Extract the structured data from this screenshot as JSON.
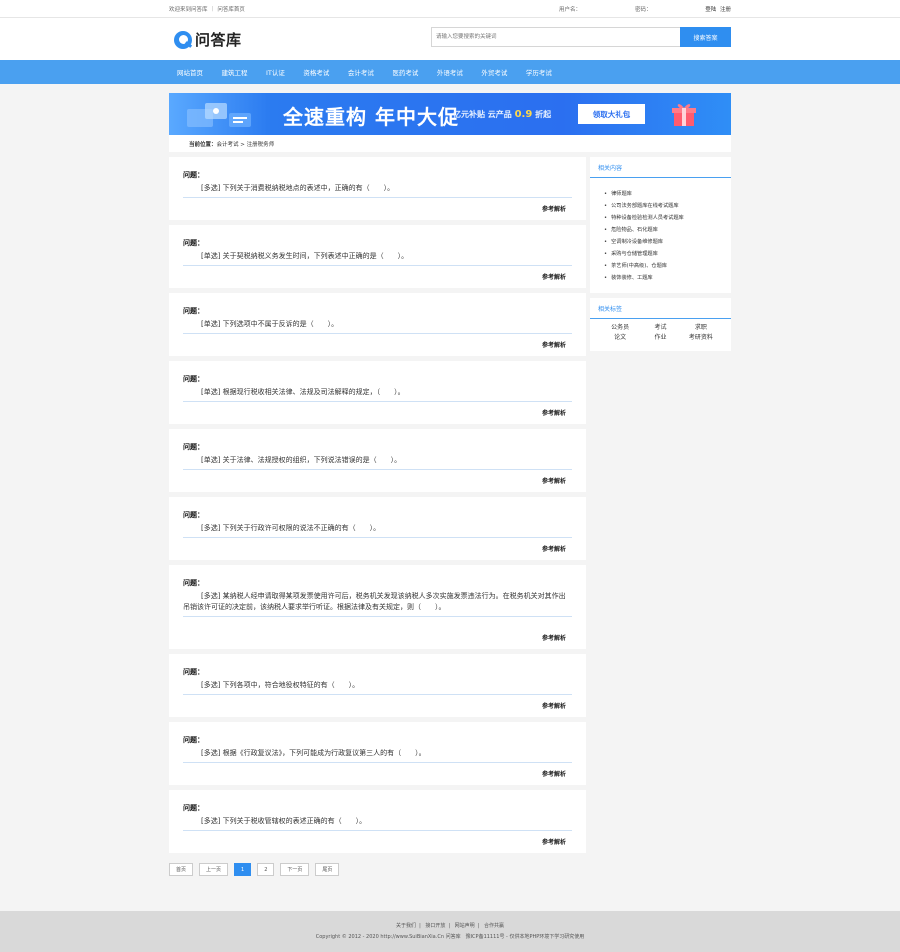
{
  "topbar": {
    "welcome": "欢迎来到问答库",
    "home_link": "问答库首页",
    "user_label": "用户名：",
    "pass_label": "密码：",
    "register": "登陆",
    "login": "注册"
  },
  "header": {
    "logo_text": "问答库",
    "search_placeholder": "请输入您要搜索的关键词",
    "search_button": "搜索答案"
  },
  "nav": [
    "网站首页",
    "建筑工程",
    "IT认证",
    "资格考试",
    "会计考试",
    "医药考试",
    "外语考试",
    "外贸考试",
    "学历考试"
  ],
  "banner": {
    "headline": "全速重构 年中大促",
    "sub_prefix": "亿元补贴 云产品",
    "sub_highlight": "0.9",
    "sub_suffix": "折起",
    "cta": "领取大礼包"
  },
  "breadcrumb": {
    "label": "当前位置：",
    "path": "会计考试 > 注册税务师"
  },
  "question_label": "问题：",
  "answer_label": "参考解析",
  "questions": [
    {
      "text": "[多选] 下列关于消费税纳税地点的表述中，正确的有（　　）。",
      "tall": false
    },
    {
      "text": "[单选] 关于契税纳税义务发生时间，下列表述中正确的是（　　）。",
      "tall": false
    },
    {
      "text": "[单选] 下列选项中不属于反诉的是（　　）。",
      "tall": false
    },
    {
      "text": "[单选] 根据现行税收相关法律、法规及司法解释的规定，（　　）。",
      "tall": false
    },
    {
      "text": "[单选] 关于法律、法规授权的组织，下列说法错误的是（　　）。",
      "tall": false
    },
    {
      "text": "[多选] 下列关于行政许可权限的说法不正确的有（　　）。",
      "tall": false
    },
    {
      "text": "[多选] 某纳税人经申请取得某项发票使用许可后，税务机关发现该纳税人多次实施发票违法行为。在税务机关对其作出吊销该许可证的决定前，该纳税人要求举行听证。根据法律及有关规定，则（　　）。",
      "tall": true
    },
    {
      "text": "[多选] 下列各项中，符合地役权特征的有（　　）。",
      "tall": false
    },
    {
      "text": "[多选] 根据《行政复议法》，下列可能成为行政复议第三人的有（　　）。",
      "tall": false
    },
    {
      "text": "[多选] 下列关于税收管辖权的表述正确的有（　　）。",
      "tall": false
    }
  ],
  "pager": [
    "首页",
    "上一页",
    "1",
    "2",
    "下一页",
    "尾页"
  ],
  "pager_current": "1",
  "sidebar": {
    "related_title": "相关内容",
    "related": [
      "律师题库",
      "公司法务部题库在线考试题库",
      "特种设备检验检测人员考试题库",
      "危险物品、石化题库",
      "空调制冷设备维修题库",
      "采购与仓储管理题库",
      "茶艺师(中高级)、仓题库",
      "装饰装修、工题库"
    ],
    "tags_title": "相关标签",
    "tags": [
      "公务员",
      "考试",
      "求职",
      "论文",
      "作业",
      "考研资料"
    ]
  },
  "footer": {
    "links": [
      "关于我们",
      "接口开放",
      "网站声明",
      "合作共赢"
    ],
    "copyright": "Copyright © 2012 - 2020 http://www.SuiBianXia.Cn 问答库　豫ICP备11111号 - 仅供本地PHP环境下学习研究使用"
  },
  "colors": {
    "accent": "#2f8ef0",
    "nav": "#4aa0f0"
  }
}
